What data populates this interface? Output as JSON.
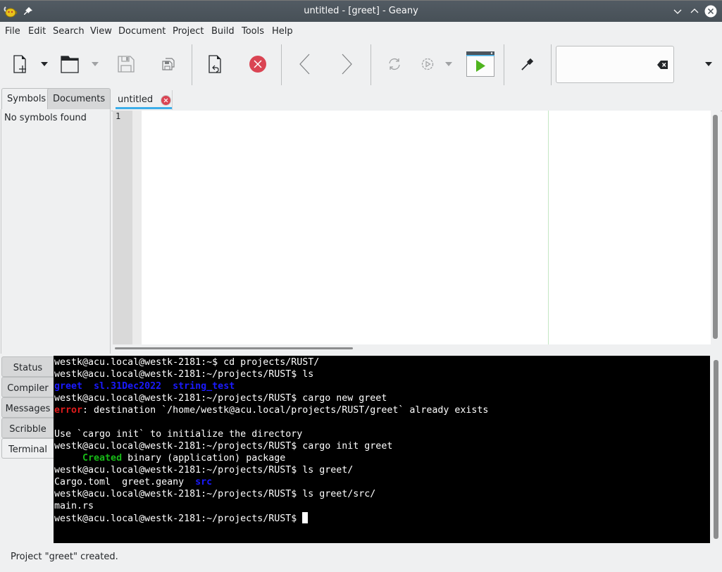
{
  "window": {
    "title": "untitled - [greet] - Geany",
    "controls": [
      "minimize",
      "maximize",
      "close"
    ]
  },
  "menu": [
    "File",
    "Edit",
    "Search",
    "View",
    "Document",
    "Project",
    "Build",
    "Tools",
    "Help"
  ],
  "toolbar": {
    "buttons": [
      "new-file",
      "new-from-template-dropdown",
      "open-file",
      "recent-files-dropdown",
      "save",
      "save-all",
      "revert",
      "close",
      "navigate-back",
      "navigate-forward",
      "compile",
      "build",
      "build-dropdown",
      "execute",
      "color-chooser",
      "search-clear",
      "toolbar-overflow"
    ],
    "search_value": ""
  },
  "sidebar": {
    "tabs": [
      "Symbols",
      "Documents"
    ],
    "active_tab": "Symbols",
    "message": "No symbols found"
  },
  "editor": {
    "tabs": [
      {
        "label": "untitled",
        "active": true
      }
    ],
    "line_numbers": [
      "1"
    ],
    "content": ""
  },
  "message_window": {
    "tabs": [
      "Status",
      "Compiler",
      "Messages",
      "Scribble",
      "Terminal"
    ],
    "active_tab": "Terminal"
  },
  "terminal": {
    "lines": [
      [
        {
          "t": "westk@acu.local@westk-2181:~$ cd projects/RUST/"
        }
      ],
      [
        {
          "t": "westk@acu.local@westk-2181:~/projects/RUST$ ls"
        }
      ],
      [
        {
          "t": "greet",
          "c": "blue"
        },
        {
          "t": "  "
        },
        {
          "t": "sl.31Dec2022",
          "c": "blue"
        },
        {
          "t": "  "
        },
        {
          "t": "string_test",
          "c": "blue"
        }
      ],
      [
        {
          "t": "westk@acu.local@westk-2181:~/projects/RUST$ cargo new greet"
        }
      ],
      [
        {
          "t": "error",
          "c": "red"
        },
        {
          "t": ": destination `/home/westk@acu.local/projects/RUST/greet` already exists"
        }
      ],
      [
        {
          "t": ""
        }
      ],
      [
        {
          "t": "Use `cargo init` to initialize the directory"
        }
      ],
      [
        {
          "t": "westk@acu.local@westk-2181:~/projects/RUST$ cargo init greet"
        }
      ],
      [
        {
          "t": "     "
        },
        {
          "t": "Created",
          "c": "green"
        },
        {
          "t": " binary (application) package"
        }
      ],
      [
        {
          "t": "westk@acu.local@westk-2181:~/projects/RUST$ ls greet/"
        }
      ],
      [
        {
          "t": "Cargo.toml  greet.geany  "
        },
        {
          "t": "src",
          "c": "blue"
        }
      ],
      [
        {
          "t": "westk@acu.local@westk-2181:~/projects/RUST$ ls greet/src/"
        }
      ],
      [
        {
          "t": "main.rs"
        }
      ],
      [
        {
          "t": "westk@acu.local@westk-2181:~/projects/RUST$ "
        },
        {
          "t": "",
          "c": "cursor"
        }
      ]
    ]
  },
  "status": {
    "text": "Project \"greet\" created."
  },
  "colors": {
    "titlebar": "#4d565e",
    "accent": "#3daee9",
    "close_red": "#da4453",
    "terminal_bg": "#000000",
    "term_blue": "#1a1aff",
    "term_red": "#e01b1b",
    "term_green": "#17b917"
  }
}
